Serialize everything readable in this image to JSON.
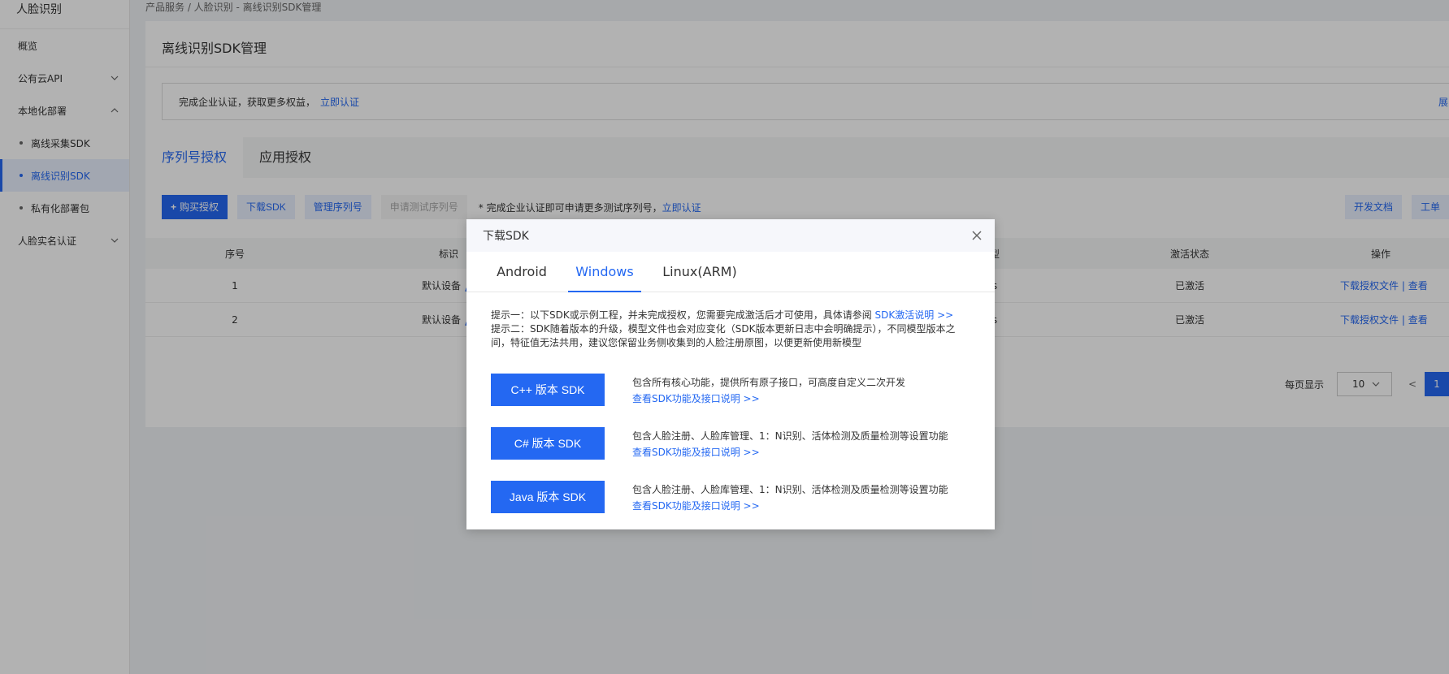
{
  "sidebar": {
    "title": "人脸识别",
    "items": [
      {
        "label": "概览"
      },
      {
        "label": "公有云API"
      },
      {
        "label": "本地化部署"
      },
      {
        "label": "离线采集SDK"
      },
      {
        "label": "离线识别SDK"
      },
      {
        "label": "私有化部署包"
      },
      {
        "label": "人脸实名认证"
      }
    ]
  },
  "breadcrumb": "产品服务 / 人脸识别 - 离线识别SDK管理",
  "page": {
    "title": "离线识别SDK管理",
    "notice_text": "完成企业认证，获取更多权益，",
    "notice_link": "立即认证",
    "notice_right": "展"
  },
  "tabs": [
    {
      "label": "序列号授权"
    },
    {
      "label": "应用授权"
    }
  ],
  "toolbar": {
    "buy": "购买授权",
    "download": "下载SDK",
    "manage": "管理序列号",
    "apply": "申请测试序列号",
    "note": "* 完成企业认证即可申请更多测试序列号，",
    "note_link": "立即认证",
    "dev_docs": "开发文档",
    "ticket": "工单"
  },
  "table": {
    "headers": [
      "序号",
      "标识",
      "型",
      "激活状态",
      "操作"
    ],
    "rows": [
      {
        "index": "1",
        "tag": "默认设备",
        "type": "s",
        "status": "已激活",
        "op1": "下载授权文件",
        "sep": "|",
        "op2": "查看"
      },
      {
        "index": "2",
        "tag": "默认设备",
        "type": "s",
        "status": "已激活",
        "op1": "下载授权文件",
        "sep": "|",
        "op2": "查看"
      }
    ]
  },
  "pager": {
    "label": "每页显示",
    "size": "10",
    "prev": "<",
    "page": "1"
  },
  "modal": {
    "title": "下载SDK",
    "tabs": [
      "Android",
      "Windows",
      "Linux(ARM)"
    ],
    "tip1": "提示一：以下SDK或示例工程，并未完成授权，您需要完成激活后才可使用，具体请参阅 ",
    "tip1_link": "SDK激活说明 >>",
    "tip2": "提示二：SDK随着版本的升级，模型文件也会对应变化（SDK版本更新日志中会明确提示），不同模型版本之间，特征值无法共用，建议您保留业务侧收集到的人脸注册原图，以便更新使用新模型",
    "sdks": [
      {
        "button": "C++ 版本 SDK",
        "desc": "包含所有核心功能，提供所有原子接口，可高度自定义二次开发",
        "link": "查看SDK功能及接口说明 >>"
      },
      {
        "button": "C# 版本 SDK",
        "desc": "包含人脸注册、人脸库管理、1：N识别、活体检测及质量检测等设置功能",
        "link": "查看SDK功能及接口说明 >>"
      },
      {
        "button": "Java 版本 SDK",
        "desc": "包含人脸注册、人脸库管理、1：N识别、活体检测及质量检测等设置功能",
        "link": "查看SDK功能及接口说明 >>"
      }
    ]
  },
  "colors": {
    "accent": "#2468f2"
  }
}
